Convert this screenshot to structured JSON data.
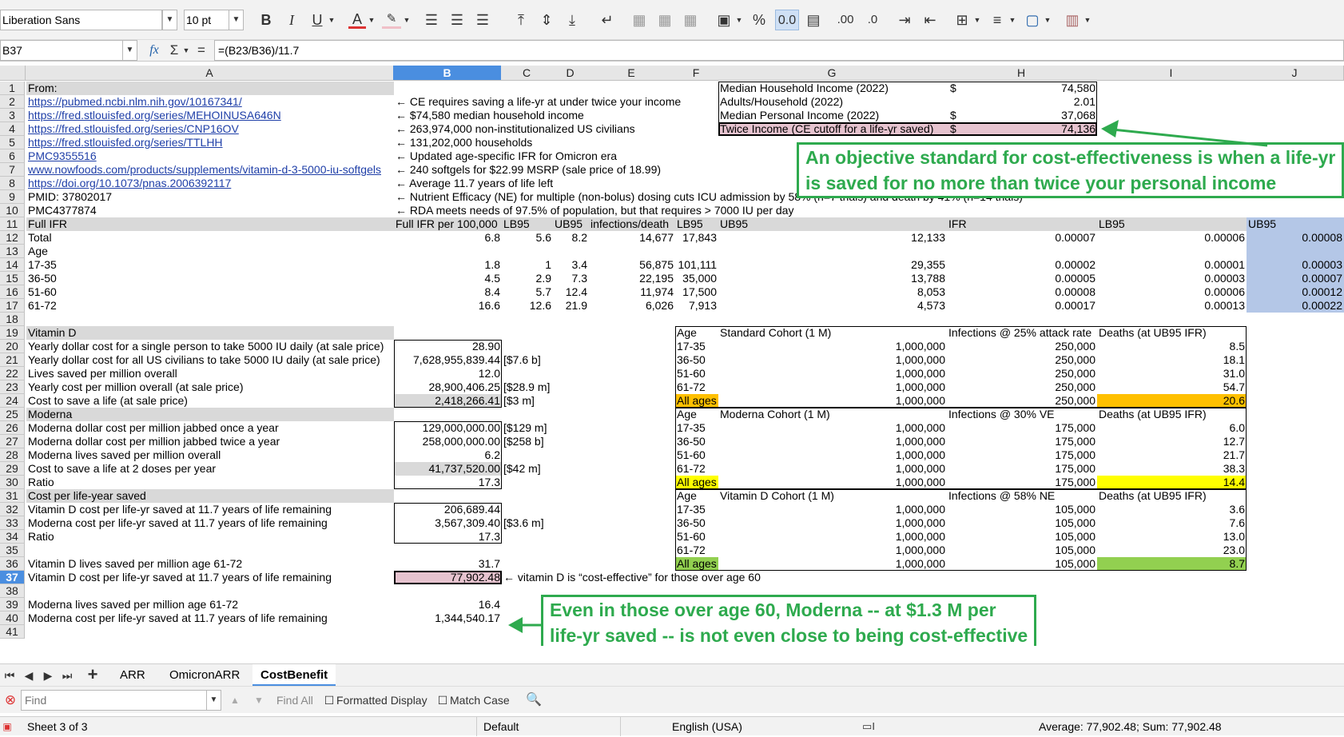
{
  "toolbar": {
    "font_name": "Liberation Sans",
    "font_size": "10 pt",
    "icons": [
      "bold-icon",
      "italic-icon",
      "underline-icon",
      "font-color-icon",
      "highlight-icon",
      "align-left-icon",
      "align-center-icon",
      "align-right-icon",
      "align-top-icon",
      "align-middle-icon",
      "align-bottom-icon",
      "wrap-text-icon",
      "merge-cells-icon",
      "currency-icon",
      "percent-icon",
      "number-format-icon",
      "date-format-icon",
      "add-decimal-icon",
      "remove-decimal-icon",
      "increase-indent-icon",
      "decrease-indent-icon",
      "borders-icon",
      "border-style-icon",
      "border-color-icon",
      "conditional-format-icon"
    ]
  },
  "formula_bar": {
    "name_box": "B37",
    "formula": "=(B23/B36)/11.7"
  },
  "columns": [
    "A",
    "B",
    "C",
    "D",
    "E",
    "F",
    "G",
    "H",
    "I",
    "J"
  ],
  "rows": [
    {
      "num": "1",
      "A": "From:",
      "G": "Median Household Income (2022)",
      "H_sym": "$",
      "H": "74,580"
    },
    {
      "num": "2",
      "A": "https://pubmed.ncbi.nlm.nih.gov/10167341/",
      "B": "← CE requires saving a life-yr at under twice your income",
      "G": "Adults/Household (2022)",
      "H": "2.01"
    },
    {
      "num": "3",
      "A": "https://fred.stlouisfed.org/series/MEHOINUSA646N",
      "B": "← $74,580 median household income",
      "G": "Median Personal Income (2022)",
      "H_sym": "$",
      "H": "37,068"
    },
    {
      "num": "4",
      "A": "https://fred.stlouisfed.org/series/CNP16OV",
      "B": "← 263,974,000 non-institutionalized US civilians",
      "G": "Twice Income (CE cutoff for a life-yr saved)",
      "H_sym": "$",
      "H": "74,136"
    },
    {
      "num": "5",
      "A": "https://fred.stlouisfed.org/series/TTLHH",
      "B": "← 131,202,000 households"
    },
    {
      "num": "6",
      "A": "PMC9355516",
      "B": "← Updated age-specific IFR for Omicron era"
    },
    {
      "num": "7",
      "A": "www.nowfoods.com/products/supplements/vitamin-d-3-5000-iu-softgels",
      "B": "← 240 softgels for $22.99 MSRP (sale price of 18.99)"
    },
    {
      "num": "8",
      "A": "https://doi.org/10.1073/pnas.2006392117",
      "B": "← Average 11.7 years of life left"
    },
    {
      "num": "9",
      "A": "PMID: 37802017",
      "B": "← Nutrient Efficacy (NE) for multiple (non-bolus) dosing cuts ICU admission by 58% (n=7 trials) and death by 41% (n=14 trials)"
    },
    {
      "num": "10",
      "A": "PMC4377874",
      "B": "← RDA meets needs of 97.5% of population, but that requires > 7000 IU per day"
    },
    {
      "num": "11",
      "A": "Full IFR",
      "B": "Full IFR per 100,000",
      "C": "LB95",
      "D": "UB95",
      "E": "infections/death",
      "F": "LB95",
      "G": "UB95",
      "H": "IFR",
      "I": "LB95",
      "J": "UB95"
    },
    {
      "num": "12",
      "A": "Total",
      "B": "6.8",
      "C": "5.6",
      "D": "8.2",
      "E": "14,677",
      "F": "17,843",
      "G": "12,133",
      "H": "0.00007",
      "I": "0.00006",
      "J": "0.00008"
    },
    {
      "num": "13",
      "A": "Age"
    },
    {
      "num": "14",
      "A": "17-35",
      "B": "1.8",
      "C": "1",
      "D": "3.4",
      "E": "56,875",
      "F": "101,111",
      "G": "29,355",
      "H": "0.00002",
      "I": "0.00001",
      "J": "0.00003"
    },
    {
      "num": "15",
      "A": "36-50",
      "B": "4.5",
      "C": "2.9",
      "D": "7.3",
      "E": "22,195",
      "F": "35,000",
      "G": "13,788",
      "H": "0.00005",
      "I": "0.00003",
      "J": "0.00007"
    },
    {
      "num": "16",
      "A": "51-60",
      "B": "8.4",
      "C": "5.7",
      "D": "12.4",
      "E": "11,974",
      "F": "17,500",
      "G": "8,053",
      "H": "0.00008",
      "I": "0.00006",
      "J": "0.00012"
    },
    {
      "num": "17",
      "A": "61-72",
      "B": "16.6",
      "C": "12.6",
      "D": "21.9",
      "E": "6,026",
      "F": "7,913",
      "G": "4,573",
      "H": "0.00017",
      "I": "0.00013",
      "J": "0.00022"
    },
    {
      "num": "18"
    },
    {
      "num": "19",
      "A": "Vitamin D",
      "F": "Age",
      "G": "Standard Cohort (1 M)",
      "H": "Infections @ 25% attack rate",
      "I": "Deaths (at UB95 IFR)"
    },
    {
      "num": "20",
      "A": "Yearly dollar cost for a single person to take 5000 IU daily (at sale price)",
      "B": "28.90",
      "F": "17-35",
      "G": "1,000,000",
      "H": "250,000",
      "I": "8.5"
    },
    {
      "num": "21",
      "A": "Yearly dollar cost for all US civilians to take 5000 IU daily (at sale price)",
      "B": "7,628,955,839.44",
      "C": "[$7.6 b]",
      "F": "36-50",
      "G": "1,000,000",
      "H": "250,000",
      "I": "18.1"
    },
    {
      "num": "22",
      "A": "Lives saved per million overall",
      "B": "12.0",
      "F": "51-60",
      "G": "1,000,000",
      "H": "250,000",
      "I": "31.0"
    },
    {
      "num": "23",
      "A": "Yearly cost per million overall (at sale price)",
      "B": "28,900,406.25",
      "C": "[$28.9 m]",
      "F": "61-72",
      "G": "1,000,000",
      "H": "250,000",
      "I": "54.7"
    },
    {
      "num": "24",
      "A": "Cost to save a life (at sale price)",
      "B": "2,418,266.41",
      "C": "[$3 m]",
      "F": "All ages",
      "G": "1,000,000",
      "H": "250,000",
      "I": "20.6"
    },
    {
      "num": "25",
      "A": "Moderna",
      "F": "Age",
      "G": "Moderna Cohort (1 M)",
      "H": "Infections @ 30% VE",
      "I": "Deaths (at UB95 IFR)"
    },
    {
      "num": "26",
      "A": "Moderna dollar cost per million jabbed once a year",
      "B": "129,000,000.00",
      "C": "[$129 m]",
      "F": "17-35",
      "G": "1,000,000",
      "H": "175,000",
      "I": "6.0"
    },
    {
      "num": "27",
      "A": "Moderna dollar cost per million jabbed twice a year",
      "B": "258,000,000.00",
      "C": "[$258 b]",
      "F": "36-50",
      "G": "1,000,000",
      "H": "175,000",
      "I": "12.7"
    },
    {
      "num": "28",
      "A": "Moderna lives saved per million overall",
      "B": "6.2",
      "F": "51-60",
      "G": "1,000,000",
      "H": "175,000",
      "I": "21.7"
    },
    {
      "num": "29",
      "A": "Cost to save a life at 2 doses per year",
      "B": "41,737,520.00",
      "C": "[$42 m]",
      "F": "61-72",
      "G": "1,000,000",
      "H": "175,000",
      "I": "38.3"
    },
    {
      "num": "30",
      "A": "Ratio",
      "B": "17.3",
      "F": "All ages",
      "G": "1,000,000",
      "H": "175,000",
      "I": "14.4"
    },
    {
      "num": "31",
      "A": "Cost per life-year saved",
      "F": "Age",
      "G": "Vitamin D Cohort (1 M)",
      "H": "Infections @ 58% NE",
      "I": "Deaths (at UB95 IFR)"
    },
    {
      "num": "32",
      "A": "Vitamin D cost per life-yr saved at 11.7 years of life remaining",
      "B": "206,689.44",
      "F": "17-35",
      "G": "1,000,000",
      "H": "105,000",
      "I": "3.6"
    },
    {
      "num": "33",
      "A": "Moderna cost per life-yr saved at 11.7 years of life remaining",
      "B": "3,567,309.40",
      "C": "[$3.6 m]",
      "F": "36-50",
      "G": "1,000,000",
      "H": "105,000",
      "I": "7.6"
    },
    {
      "num": "34",
      "A": "Ratio",
      "B": "17.3",
      "F": "51-60",
      "G": "1,000,000",
      "H": "105,000",
      "I": "13.0"
    },
    {
      "num": "35",
      "F": "61-72",
      "G": "1,000,000",
      "H": "105,000",
      "I": "23.0"
    },
    {
      "num": "36",
      "A": "Vitamin D lives saved per million age 61-72",
      "B": "31.7",
      "F": "All ages",
      "G": "1,000,000",
      "H": "105,000",
      "I": "8.7"
    },
    {
      "num": "37",
      "A": "Vitamin D cost per life-yr saved at 11.7 years of life remaining",
      "B": "77,902.48",
      "C": "← vitamin D is “cost-effective” for those over age 60"
    },
    {
      "num": "38"
    },
    {
      "num": "39",
      "A": "Moderna lives saved per million age 61-72",
      "B": "16.4"
    },
    {
      "num": "40",
      "A": "Moderna cost per life-yr saved at 11.7 years of life remaining",
      "B": "1,344,540.17"
    },
    {
      "num": "41"
    }
  ],
  "callouts": {
    "top": [
      "An objective standard for cost-effectiveness is when a life-yr",
      "is saved for no more than twice your personal income"
    ],
    "bottom": [
      "Even in those over age 60, Moderna -- at $1.3 M per",
      "life-yr saved -- is not even close to being cost-effective"
    ]
  },
  "sheet_tabs": [
    "ARR",
    "OmicronARR",
    "CostBenefit"
  ],
  "active_tab": "CostBenefit",
  "find_bar": {
    "placeholder": "Find",
    "find_all": "Find All",
    "formatted_display": "Formatted Display",
    "match_case": "Match Case"
  },
  "status": {
    "sheet": "Sheet 3 of 3",
    "style": "Default",
    "language": "English (USA)",
    "summary": "Average: 77,902.48; Sum: 77,902.48"
  },
  "colors": {
    "selection": "#4a8ee0",
    "callout": "#2eaa4e",
    "pink": "#e6c3cf",
    "orange": "#ffc000",
    "yellow": "#ffff00",
    "green": "#92d050",
    "blue": "#b4c7e7",
    "gray": "#d9d9d9"
  }
}
